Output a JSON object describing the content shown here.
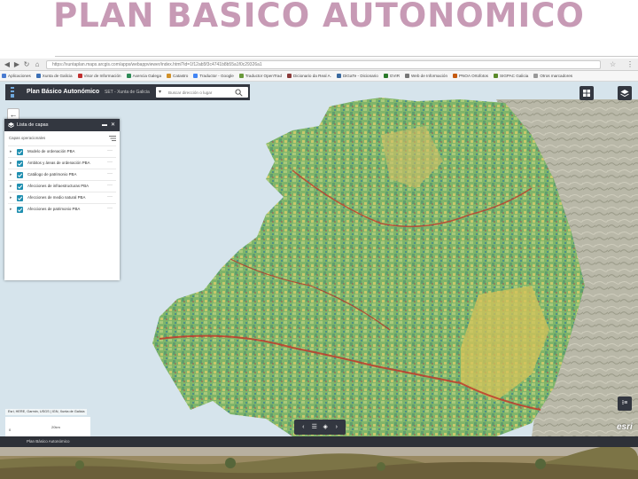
{
  "slide": {
    "title": "PLAN BASICO AUTONOMICO"
  },
  "browser": {
    "back_glyph": "◀",
    "forward_glyph": "▶",
    "reload_glyph": "↻",
    "home_glyph": "⌂",
    "url": "https://xuntaplan.maps.arcgis.com/apps/webappviewer/index.html?id=1f12ab5f3c4741b8b55a1f0c29326a1",
    "star_icon": "star-icon",
    "menu_glyph": "⋮",
    "bookmarks": [
      {
        "label": "Aplicaciones",
        "color": "#4a7bd0"
      },
      {
        "label": "Xunta de Galicia",
        "color": "#3b6fb5"
      },
      {
        "label": "Visor de Información",
        "color": "#c03030"
      },
      {
        "label": "Axencia Galega",
        "color": "#2e8b57"
      },
      {
        "label": "Catastro",
        "color": "#d0912a"
      },
      {
        "label": "Traductor - Google",
        "color": "#4285f4"
      },
      {
        "label": "Traductor OpenTrad",
        "color": "#6a9a3c"
      },
      {
        "label": "Dicionario da Real A.",
        "color": "#8b3b3b"
      },
      {
        "label": "DiGaTe - Dicionario",
        "color": "#3a6aa0"
      },
      {
        "label": "GVIR",
        "color": "#2a7a2a"
      },
      {
        "label": "Web de Información",
        "color": "#777777"
      },
      {
        "label": "PNOA Ortofotos",
        "color": "#c55a11"
      },
      {
        "label": "SIGPAC Galicia",
        "color": "#5a8a2a"
      },
      {
        "label": "Otros marcadores",
        "color": "#999999"
      }
    ]
  },
  "app": {
    "title": "Plan Básico Autonómico",
    "subtitle": "SET - Xunta de Galicia",
    "search_placeholder": "Buscar dirección o lugar",
    "logo_icon": "xunta-logo-icon",
    "header_color": "#333740",
    "accent_color": "#1f8fb0"
  },
  "layer_panel": {
    "title": "Lista de capas",
    "operational_label": "Capas operacionales",
    "minimize_glyph": "▬",
    "close_glyph": "✕",
    "layers": [
      {
        "name": "Modelo de ordenación PBA",
        "checked": true
      },
      {
        "name": "Ámbitos y áreas de ordenación PBA",
        "checked": true
      },
      {
        "name": "Catálogo de patrimonio PBA",
        "checked": true
      },
      {
        "name": "Afecciones de infraestructuras PBA",
        "checked": true
      },
      {
        "name": "Afecciones de medio natural PBA",
        "checked": true
      },
      {
        "name": "Afecciones de patrimonio PBA",
        "checked": true
      }
    ],
    "expand_glyph": "▸",
    "row_menu_glyph": "···"
  },
  "map": {
    "zoom_glyph": "←",
    "attribution": "Esri, HERE, Garmin, USGS | IGN, Xunta de Galicia",
    "scale_left": "0",
    "scale_mid": "20km",
    "esri_label": "esri",
    "legend_glyph": "⁝≡"
  },
  "toolbar": {
    "prev_glyph": "‹",
    "list_glyph": "☰",
    "layers_glyph": "◈",
    "next_glyph": "›"
  },
  "footer": {
    "label": "Plan Básico Autonómico"
  }
}
